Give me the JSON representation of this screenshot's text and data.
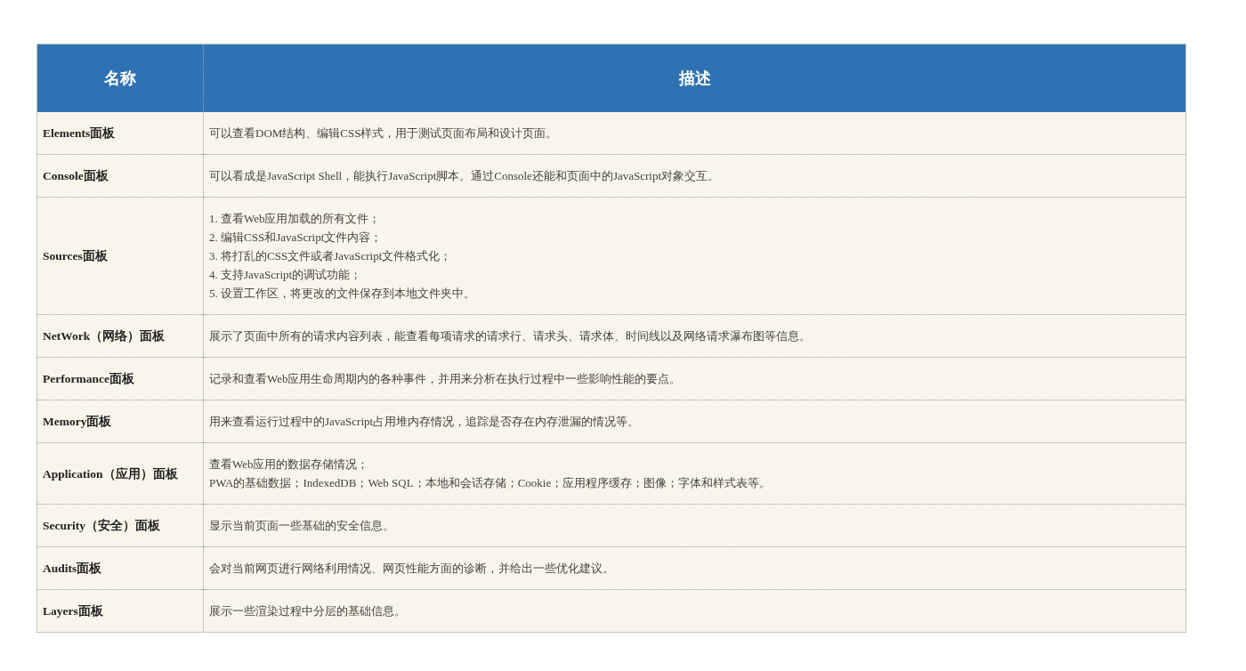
{
  "table": {
    "columns": [
      "名称",
      "描述"
    ],
    "rows": [
      {
        "name": "Elements面板",
        "description": [
          "可以查看DOM结构、编辑CSS样式，用于测试页面布局和设计页面。"
        ]
      },
      {
        "name": "Console面板",
        "description": [
          "可以看成是JavaScript Shell，能执行JavaScript脚本。通过Console还能和页面中的JavaScript对象交互。"
        ]
      },
      {
        "name": "Sources面板",
        "description": [
          "1. 查看Web应用加载的所有文件；",
          "2. 编辑CSS和JavaScript文件内容；",
          "3. 将打乱的CSS文件或者JavaScript文件格式化；",
          "4. 支持JavaScript的调试功能；",
          "5. 设置工作区，将更改的文件保存到本地文件夹中。"
        ]
      },
      {
        "name": "NetWork（网络）面板",
        "description": [
          "展示了页面中所有的请求内容列表，能查看每项请求的请求行、请求头、请求体、时间线以及网络请求瀑布图等信息。"
        ]
      },
      {
        "name": "Performance面板",
        "description": [
          "记录和查看Web应用生命周期内的各种事件，并用来分析在执行过程中一些影响性能的要点。"
        ]
      },
      {
        "name": "Memory面板",
        "description": [
          "用来查看运行过程中的JavaScript占用堆内存情况，追踪是否存在内存泄漏的情况等。"
        ]
      },
      {
        "name": "Application（应用）面板",
        "description": [
          "查看Web应用的数据存储情况；",
          "PWA的基础数据；IndexedDB；Web SQL；本地和会话存储；Cookie；应用程序缓存；图像；字体和样式表等。"
        ]
      },
      {
        "name": "Security（安全）面板",
        "description": [
          "显示当前页面一些基础的安全信息。"
        ]
      },
      {
        "name": "Audits面板",
        "description": [
          "会对当前网页进行网络利用情况、网页性能方面的诊断，并给出一些优化建议。"
        ]
      },
      {
        "name": "Layers面板",
        "description": [
          "展示一些渲染过程中分层的基础信息。"
        ]
      }
    ]
  }
}
